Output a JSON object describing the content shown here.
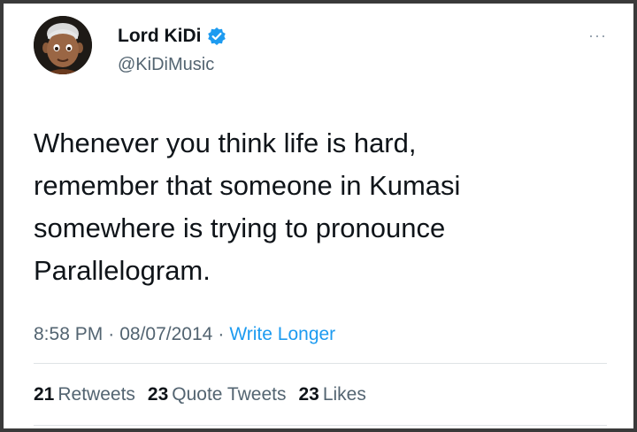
{
  "author": {
    "display_name": "Lord KiDi",
    "handle": "@KiDiMusic",
    "verified_icon": "verified-badge-icon",
    "avatar_icon": "memoji-avatar"
  },
  "more_icon": "···",
  "tweet": {
    "lines": [
      "Whenever you think life is hard,",
      "remember that someone in Kumasi",
      "somewhere is trying to pronounce",
      "Parallelogram."
    ]
  },
  "meta": {
    "time": "8:58 PM",
    "separator": "·",
    "date": "08/07/2014",
    "source": "Write Longer"
  },
  "stats": {
    "retweets_count": "21",
    "retweets_label": "Retweets",
    "quotes_count": "23",
    "quotes_label": "Quote Tweets",
    "likes_count": "23",
    "likes_label": "Likes"
  },
  "colors": {
    "link": "#1d9bf0",
    "text": "#0f1419",
    "secondary": "#536471"
  }
}
